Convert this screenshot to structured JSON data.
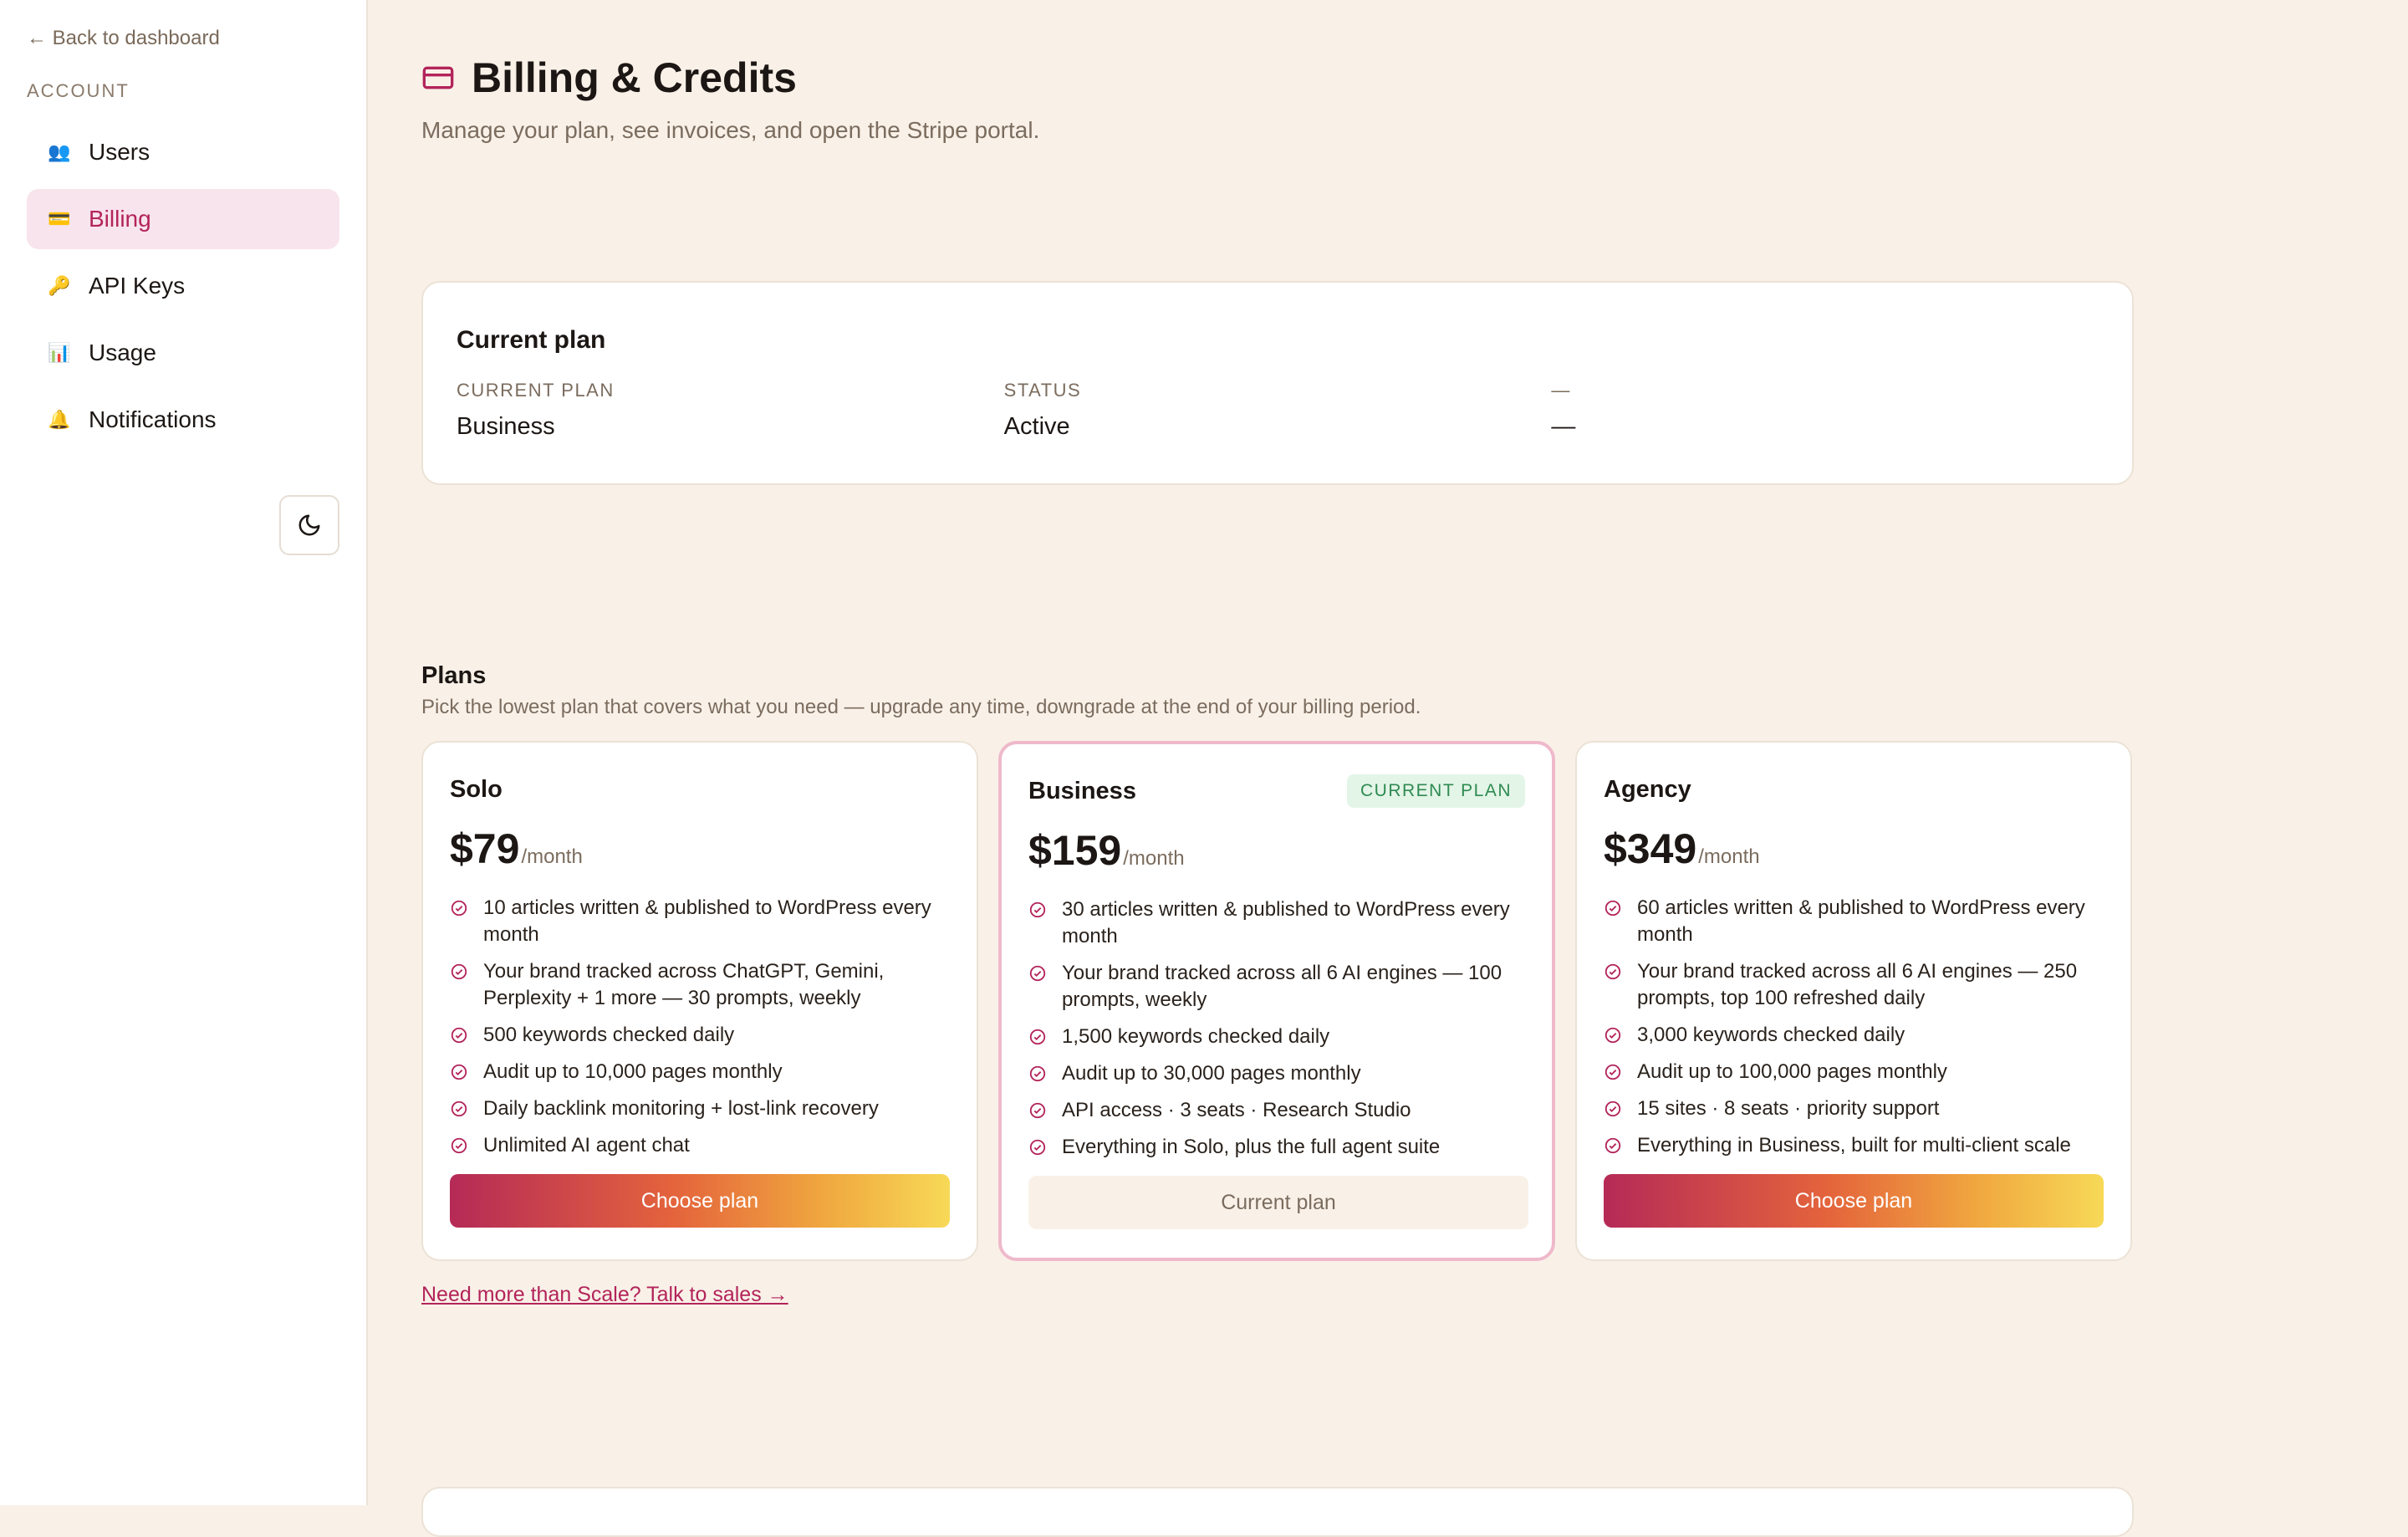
{
  "sidebar": {
    "back_label": "← Back to dashboard",
    "section_label": "ACCOUNT",
    "items": [
      {
        "label": "Users",
        "icon": "users-icon",
        "glyph": "👥",
        "active": false
      },
      {
        "label": "Billing",
        "icon": "credit-card-icon",
        "glyph": "💳",
        "active": true
      },
      {
        "label": "API Keys",
        "icon": "key-icon",
        "glyph": "🔑",
        "active": false
      },
      {
        "label": "Usage",
        "icon": "bar-chart-icon",
        "glyph": "📊",
        "active": false
      },
      {
        "label": "Notifications",
        "icon": "bell-icon",
        "glyph": "🔔",
        "active": false
      }
    ],
    "theme_toggle_icon": "moon-icon"
  },
  "header": {
    "title": "Billing & Credits",
    "subtitle": "Manage your plan, see invoices, and open the Stripe portal.",
    "icon": "credit-card-icon"
  },
  "current_plan": {
    "heading": "Current plan",
    "fields": [
      {
        "label": "CURRENT PLAN",
        "value": "Business"
      },
      {
        "label": "STATUS",
        "value": "Active"
      },
      {
        "label": "—",
        "value": "—"
      }
    ]
  },
  "plans_section": {
    "title": "Plans",
    "subtitle": "Pick the lowest plan that covers what you need — upgrade any time, downgrade at the end of your billing period.",
    "plans": [
      {
        "name": "Solo",
        "price": "$79",
        "period": "/month",
        "badge": "",
        "features": [
          "10 articles written & published to WordPress every month",
          "Your brand tracked across ChatGPT, Gemini, Perplexity + 1 more — 30 prompts, weekly",
          "500 keywords checked daily",
          "Audit up to 10,000 pages monthly",
          "Daily backlink monitoring + lost-link recovery",
          "Unlimited AI agent chat"
        ],
        "button_label": "Choose plan",
        "is_current": false
      },
      {
        "name": "Business",
        "price": "$159",
        "period": "/month",
        "badge": "CURRENT PLAN",
        "features": [
          "30 articles written & published to WordPress every month",
          "Your brand tracked across all 6 AI engines — 100 prompts, weekly",
          "1,500 keywords checked daily",
          "Audit up to 30,000 pages monthly",
          "API access · 3 seats · Research Studio",
          "Everything in Solo, plus the full agent suite"
        ],
        "button_label": "Current plan",
        "is_current": true
      },
      {
        "name": "Agency",
        "price": "$349",
        "period": "/month",
        "badge": "",
        "features": [
          "60 articles written & published to WordPress every month",
          "Your brand tracked across all 6 AI engines — 250 prompts, top 100 refreshed daily",
          "3,000 keywords checked daily",
          "Audit up to 100,000 pages monthly",
          "15 sites · 8 seats · priority support",
          "Everything in Business, built for multi-client scale"
        ],
        "button_label": "Choose plan",
        "is_current": false
      }
    ],
    "sales_link": "Need more than Scale? Talk to sales →"
  },
  "colors": {
    "accent": "#b3245a",
    "background": "#f9f1e8",
    "active_nav_bg": "#f8e4ec",
    "badge_bg": "#e3f5e7",
    "badge_text": "#2f8a52"
  }
}
